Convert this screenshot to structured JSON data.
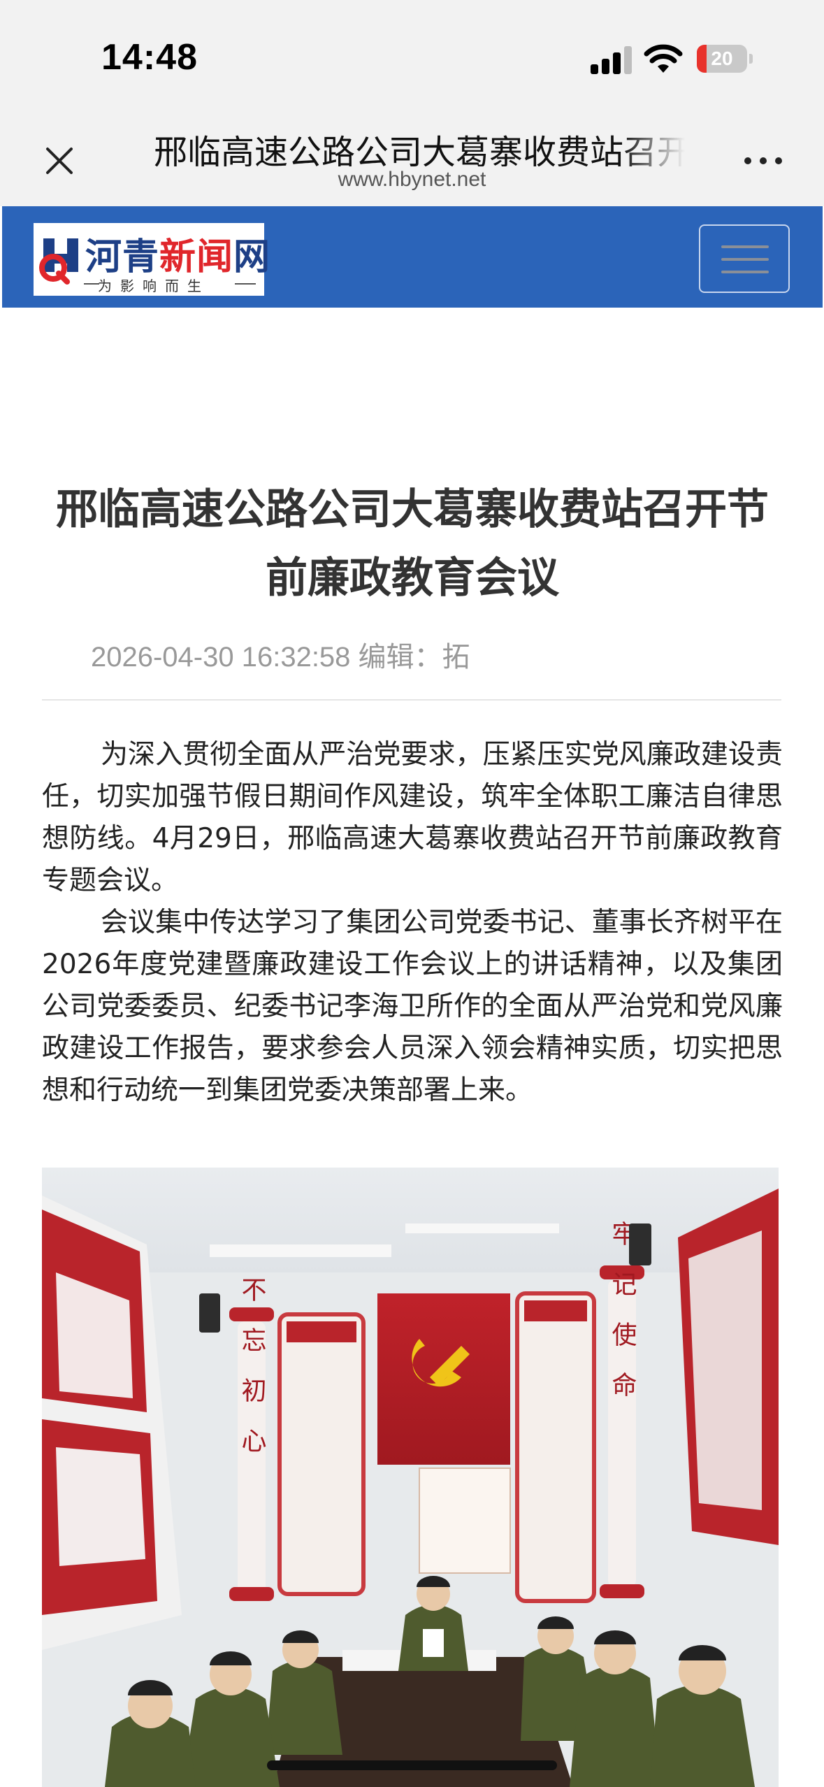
{
  "status_bar": {
    "time": "14:48",
    "battery": "20",
    "battery_level": 0.2
  },
  "browser": {
    "tab_title": "邢临高速公路公司大葛寨收费站召开节前廉政教育会议",
    "url": "www.hbynet.net",
    "close_icon": "close-icon",
    "more_icon": "more-icon"
  },
  "site": {
    "logo_text_main": "河青",
    "logo_text_accent": "新闻",
    "logo_text_end": "网",
    "slogan": "为影响而生",
    "menu_icon": "hamburger-menu-icon",
    "brand_color": "#2b64b9"
  },
  "article": {
    "title": "邢临高速公路公司大葛寨收费站召开节前廉政教育会议",
    "meta": "2026-04-30 16:32:58 编辑：拓",
    "paragraphs": [
      "为深入贯彻全面从严治党要求，压紧压实党风廉政建设责任，切实加强节假日期间作风建设，筑牢全体职工廉洁自律思想防线。4月29日，邢临高速大葛寨收费站召开节前廉政教育专题会议。",
      "会议集中传达学习了集团公司党委书记、董事长齐树平在2026年度党建暨廉政建设工作会议上的讲话精神，以及集团公司党委委员、纪委书记李海卫所作的全面从严治党和党风廉政建设工作报告，要求参会人员深入领会精神实质，切实把思想和行动统一到集团党委决策部署上来。"
    ],
    "photo_wall_left": "不忘初心",
    "photo_wall_right": "牢记使命"
  }
}
